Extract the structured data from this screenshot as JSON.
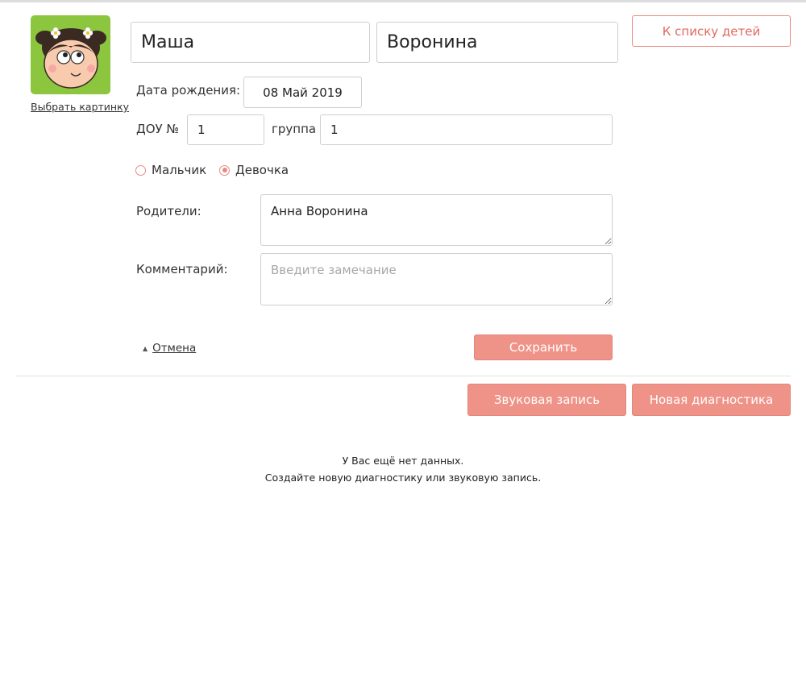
{
  "avatar": {
    "pick_label": "Выбрать картинку"
  },
  "child": {
    "first_name": "Маша",
    "last_name": "Воронина"
  },
  "header": {
    "back_button": "К списку детей"
  },
  "birth": {
    "label": "Дата рождения:",
    "value": "08 Май 2019"
  },
  "dou": {
    "label": "ДОУ №",
    "value": "1"
  },
  "group": {
    "label": "группа",
    "value": "1"
  },
  "gender": {
    "options": [
      {
        "label": "Мальчик",
        "checked": false
      },
      {
        "label": "Девочка",
        "checked": true
      }
    ]
  },
  "parents": {
    "label": "Родители:",
    "value": "Анна Воронина"
  },
  "comment": {
    "label": "Комментарий:",
    "value": "",
    "placeholder": "Введите замечание"
  },
  "actions": {
    "cancel": "Отмена",
    "save": "Сохранить"
  },
  "records": {
    "audio_button": "Звуковая запись",
    "diagnostics_button": "Новая диагностика"
  },
  "empty_state": {
    "line1": "У Вас ещё нет данных.",
    "line2": "Создайте новую диагностику или звуковую запись."
  },
  "colors": {
    "accent": "#ef9287",
    "accent_text": "#e0695c",
    "avatar_bg": "#8cc63f"
  }
}
